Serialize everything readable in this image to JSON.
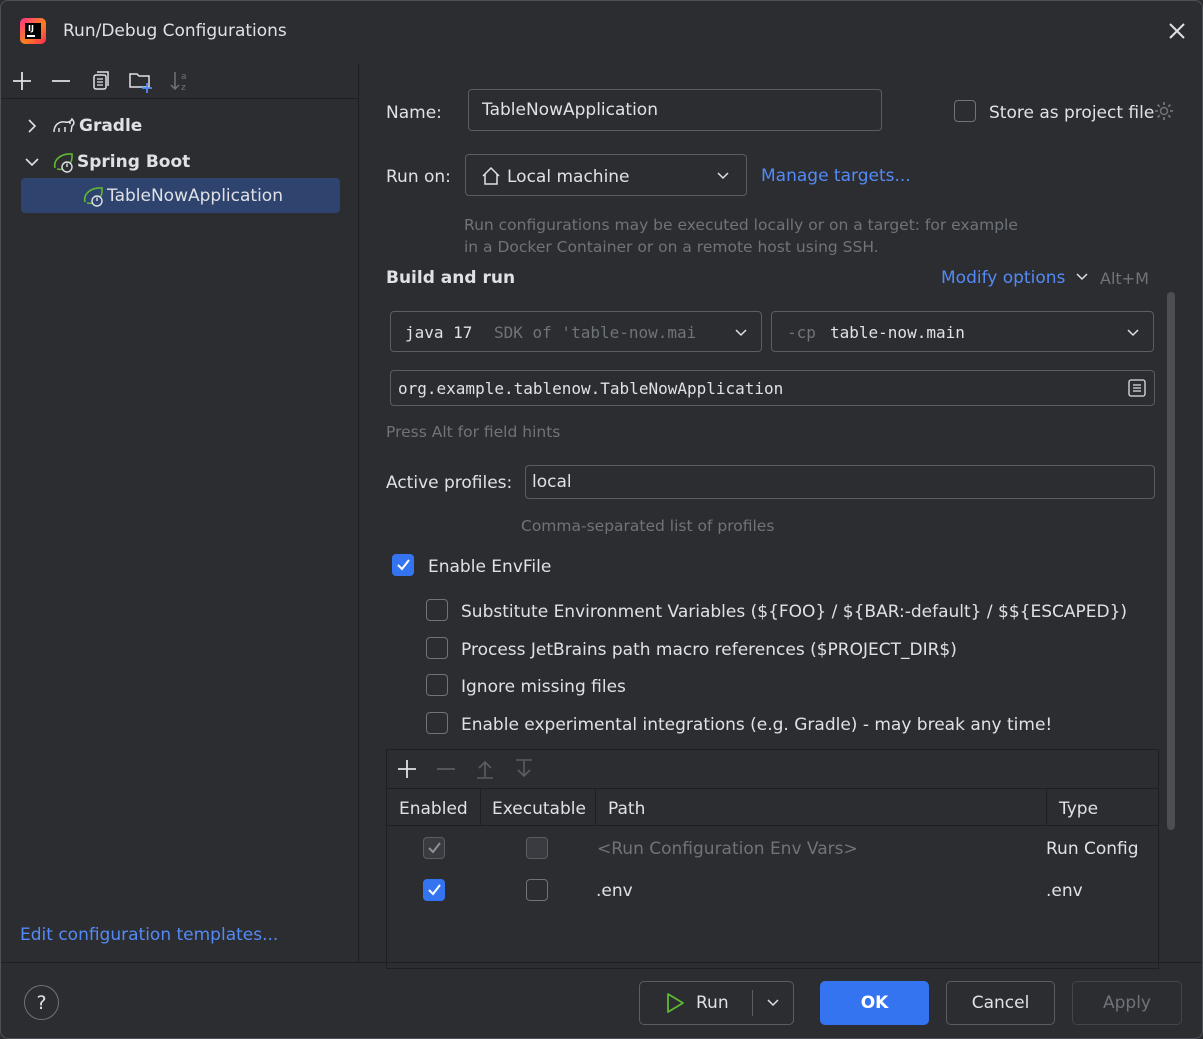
{
  "window": {
    "title": "Run/Debug Configurations"
  },
  "tree": {
    "items": [
      {
        "label": "Gradle",
        "expanded": false
      },
      {
        "label": "Spring Boot",
        "expanded": true
      },
      {
        "label": "TableNowApplication",
        "selected": true
      }
    ],
    "edit_templates": "Edit configuration templates..."
  },
  "form": {
    "name_label": "Name:",
    "name_value": "TableNowApplication",
    "store_label": "Store as project file",
    "run_on_label": "Run on:",
    "run_on_value": "Local machine",
    "manage_targets": "Manage targets...",
    "run_on_hint_1": "Run configurations may be executed locally or on a target: for example",
    "run_on_hint_2": "in a Docker Container or on a remote host using SSH.",
    "section_title": "Build and run",
    "modify_options": "Modify options",
    "modify_shortcut": "Alt+M",
    "sdk_java": "java 17",
    "sdk_rest": "SDK of 'table-now.mai",
    "cp_prefix": "-cp",
    "cp_value": "table-now.main",
    "main_class": "org.example.tablenow.TableNowApplication",
    "field_hint": "Press Alt for field hints",
    "profiles_label": "Active profiles:",
    "profiles_value": "local",
    "profiles_hint": "Comma-separated list of profiles"
  },
  "envfile": {
    "enable_label": "Enable EnvFile",
    "enabled": true,
    "options": [
      {
        "label": "Substitute Environment Variables (${FOO} / ${BAR:-default} / $${ESCAPED})",
        "checked": false
      },
      {
        "label": "Process JetBrains path macro references ($PROJECT_DIR$)",
        "checked": false
      },
      {
        "label": "Ignore missing files",
        "checked": false
      },
      {
        "label": "Enable experimental integrations (e.g. Gradle) - may break any time!",
        "checked": false
      }
    ],
    "table": {
      "headers": [
        "Enabled",
        "Executable",
        "Path",
        "Type"
      ],
      "rows": [
        {
          "enabled": true,
          "enabled_disabled": true,
          "executable": false,
          "path": "<Run Configuration Env Vars>",
          "type": "Run Config"
        },
        {
          "enabled": true,
          "enabled_disabled": false,
          "executable": false,
          "path": ".env",
          "type": ".env"
        }
      ]
    }
  },
  "footer": {
    "help": "?",
    "run": "Run",
    "ok": "OK",
    "cancel": "Cancel",
    "apply": "Apply"
  },
  "colors": {
    "accent": "#3574f0",
    "link": "#548af7",
    "background": "#2b2d30",
    "selection": "#2e436e",
    "spring": "#5fb832"
  }
}
